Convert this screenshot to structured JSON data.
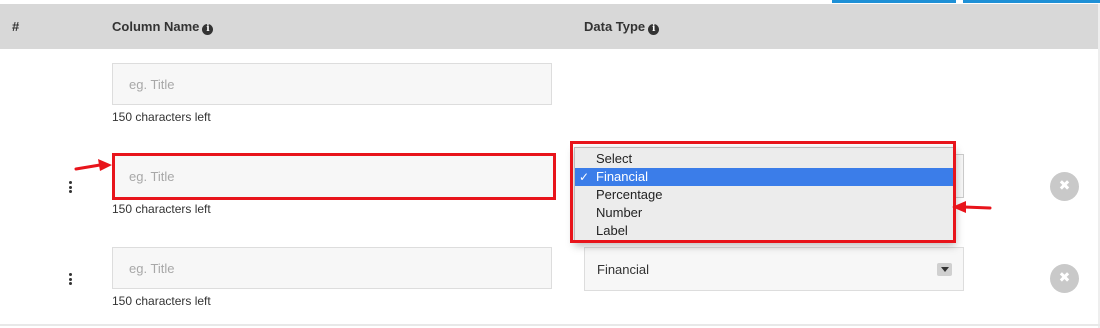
{
  "header": {
    "hash_label": "#",
    "column_name_label": "Column Name",
    "data_type_label": "Data Type",
    "info_glyph": "i"
  },
  "rows": [
    {
      "column_name_placeholder": "eg. Title",
      "chars_left": "150 characters left"
    },
    {
      "column_name_placeholder": "eg. Title",
      "chars_left": "150 characters left"
    },
    {
      "column_name_placeholder": "eg. Title",
      "chars_left": "150 characters left",
      "data_type_value": "Financial"
    }
  ],
  "data_type_dropdown": {
    "options": [
      "Select",
      "Financial",
      "Percentage",
      "Number",
      "Label"
    ],
    "selected": "Financial",
    "check_glyph": "✓"
  },
  "remove_glyph": "✖",
  "colors": {
    "accent_blue": "#1e90d6",
    "highlight_red": "#e8141b",
    "selection_blue": "#3b7de9",
    "header_gray": "#d8d8d8"
  }
}
